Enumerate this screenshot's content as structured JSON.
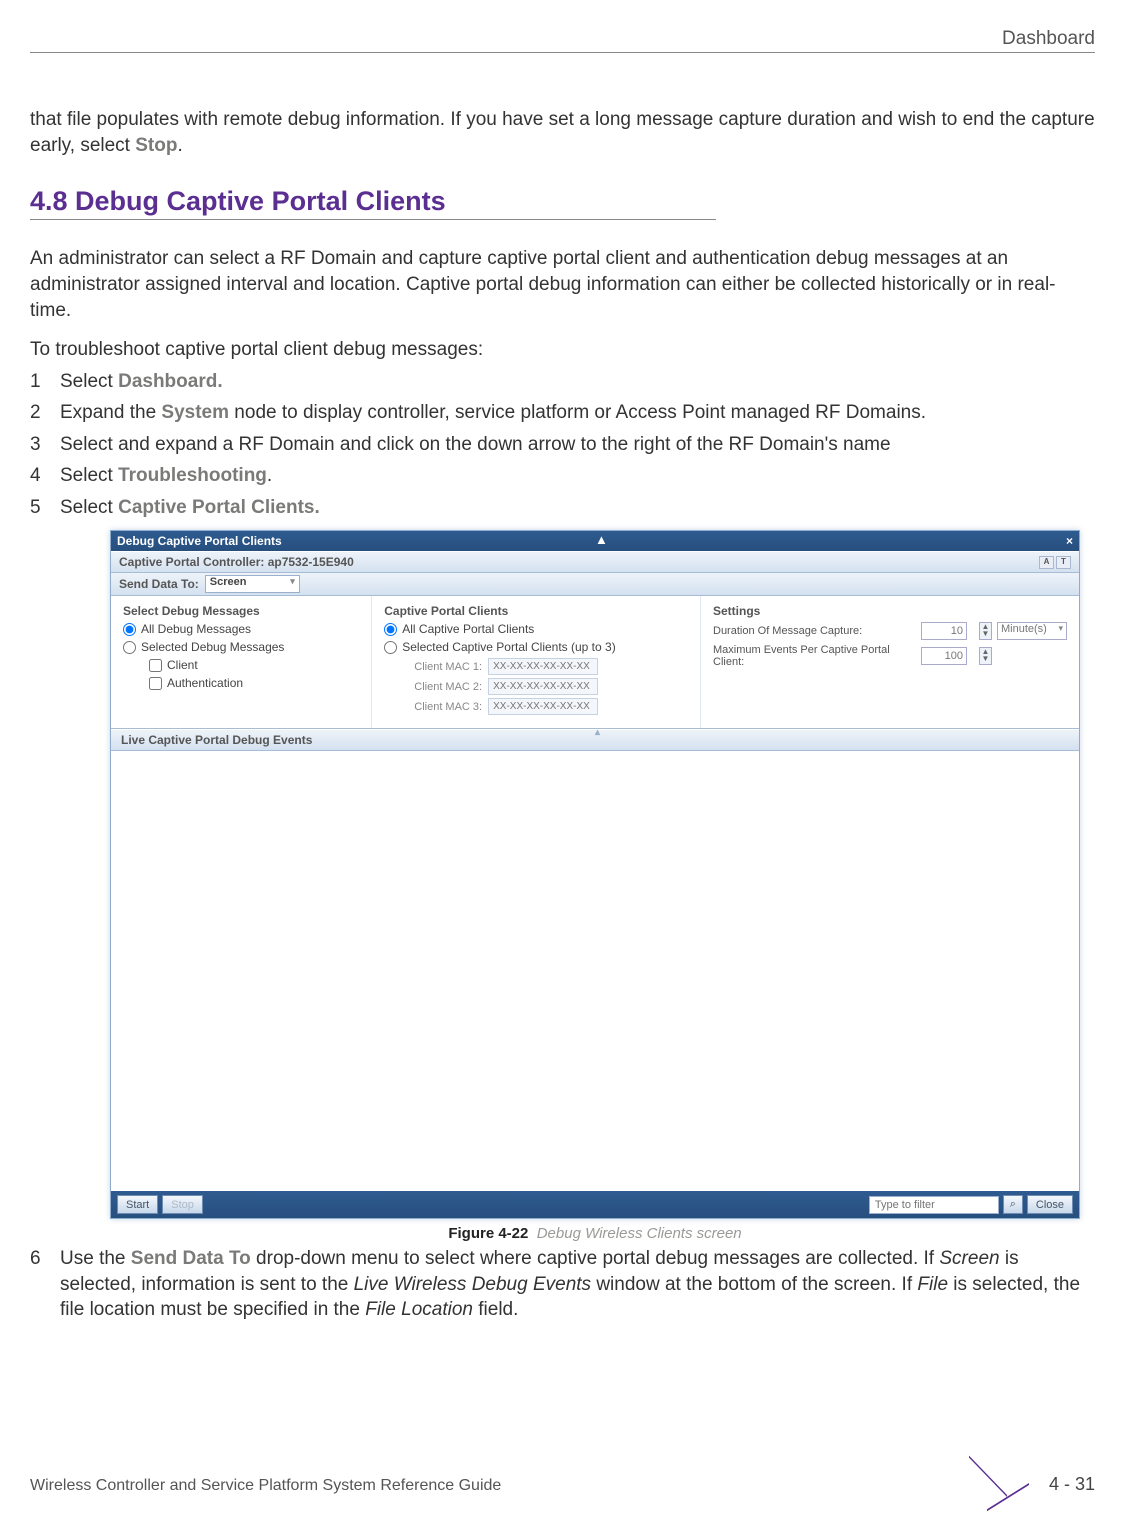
{
  "chapter": "Dashboard",
  "lead": {
    "pre": "that file populates with remote debug information. If you have set a long message capture duration and wish to end the capture early, select ",
    "stop": "Stop",
    "post": "."
  },
  "section_heading": "4.8 Debug Captive Portal Clients",
  "intro": "An administrator can select a RF Domain and capture captive portal client and authentication debug messages at an administrator assigned interval and location. Captive portal debug information can either be collected historically or in real-time.",
  "instruction_line": "To troubleshoot captive portal client debug messages:",
  "steps": {
    "s1_pre": "Select ",
    "s1_b": "Dashboard.",
    "s2_pre": "Expand the ",
    "s2_b": "System",
    "s2_post": " node to display controller, service platform or Access Point managed RF Domains.",
    "s3": "Select and expand a RF Domain and click on the down arrow to the right of the RF Domain's name",
    "s4_pre": "Select ",
    "s4_b": "Troubleshooting",
    "s4_post": ".",
    "s5_pre": "Select ",
    "s5_b": "Captive Portal Clients."
  },
  "shot": {
    "title": "Debug Captive Portal Clients",
    "controller": "Captive Portal Controller: ap7532-15E940",
    "send_label": "Send Data To:",
    "send_value": "Screen",
    "left_title": "Select Debug Messages",
    "left_all": "All Debug Messages",
    "left_sel": "Selected Debug Messages",
    "left_client": "Client",
    "left_auth": "Authentication",
    "center_title": "Captive Portal Clients",
    "center_all": "All Captive Portal Clients",
    "center_sel": "Selected Captive Portal Clients (up to 3)",
    "mac1_l": "Client MAC 1:",
    "mac2_l": "Client MAC 2:",
    "mac3_l": "Client MAC 3:",
    "mac_ph": "XX-XX-XX-XX-XX-XX",
    "right_title": "Settings",
    "right_dur_l": "Duration Of Message Capture:",
    "right_dur_v": "10",
    "right_dur_u": "Minute(s)",
    "right_max_l": "Maximum Events Per Captive Portal Client:",
    "right_max_v": "100",
    "live_title": "Live Captive Portal Debug Events",
    "start": "Start",
    "stop": "Stop",
    "filter_ph": "Type to filter",
    "close": "Close"
  },
  "figcap_label": "Figure 4-22",
  "figcap_title": "Debug Wireless Clients screen",
  "step6": {
    "pre": "Use the ",
    "b": "Send Data To",
    "mid1": " drop-down menu to select where captive portal debug messages are collected. If ",
    "i1": "Screen",
    "mid2": " is selected, information is sent to the ",
    "i2": "Live Wireless Debug Events",
    "mid3": " window at the bottom of the screen. If ",
    "i3": "File",
    "mid4": " is selected, the file location must be specified in the ",
    "i4": "File Location",
    "end": " field."
  },
  "footer_title": "Wireless Controller and Service Platform System Reference Guide",
  "page_number": "4 - 31"
}
